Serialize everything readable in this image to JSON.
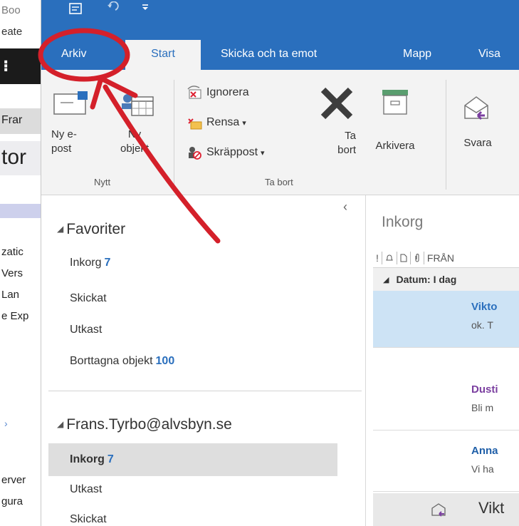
{
  "background_window": {
    "title_fragment": "Boo",
    "line2_fragment": "eate",
    "frans_fragment": "Frar",
    "tor_fragment": "tor",
    "items": [
      "zatic",
      "Vers",
      "Lan",
      "e Exp",
      "erver",
      "gura"
    ]
  },
  "ribbon_tabs": [
    {
      "label": "Arkiv",
      "active": false
    },
    {
      "label": "Start",
      "active": true
    },
    {
      "label": "Skicka och ta emot",
      "active": false
    },
    {
      "label": "Mapp",
      "active": false
    },
    {
      "label": "Visa",
      "active": false
    }
  ],
  "ribbon": {
    "new_email_label": "Ny e-\npost",
    "new_item_label": "Ny\nobjekt",
    "ignore_label": "Ignorera",
    "clean_label": "Rensa",
    "junk_label": "Skräppost",
    "delete_label": "Ta\nbort",
    "archive_label": "Arkivera",
    "reply_label": "Svara",
    "group_new": "Nytt",
    "group_delete": "Ta bort"
  },
  "folder_pane": {
    "favorites_header": "Favoriter",
    "favorites": [
      {
        "name": "Inkorg",
        "count": "7"
      },
      {
        "name": "Skickat",
        "count": ""
      },
      {
        "name": "Utkast",
        "count": ""
      },
      {
        "name": "Borttagna objekt",
        "count": "100"
      }
    ],
    "account_header": "Frans.Tyrbo@alvsbyn.se",
    "account_folders": [
      {
        "name": "Inkorg",
        "count": "7",
        "selected": true
      },
      {
        "name": "Utkast",
        "count": "",
        "selected": false
      },
      {
        "name": "Skickat",
        "count": "",
        "selected": false
      }
    ]
  },
  "message_pane": {
    "title": "Inkorg",
    "from_header": "FRÅN",
    "group_label": "Datum: I dag",
    "messages": [
      {
        "sender": "Vikto",
        "preview": "ok. T",
        "selected": true
      },
      {
        "sender": "Dusti",
        "preview": "Bli m",
        "selected": false
      },
      {
        "sender": "Anna",
        "preview": "Vi ha",
        "selected": false
      }
    ],
    "bottom_sender": "Vikt"
  },
  "colors": {
    "accent": "#2a6fbd",
    "annotation": "#d4202a"
  }
}
